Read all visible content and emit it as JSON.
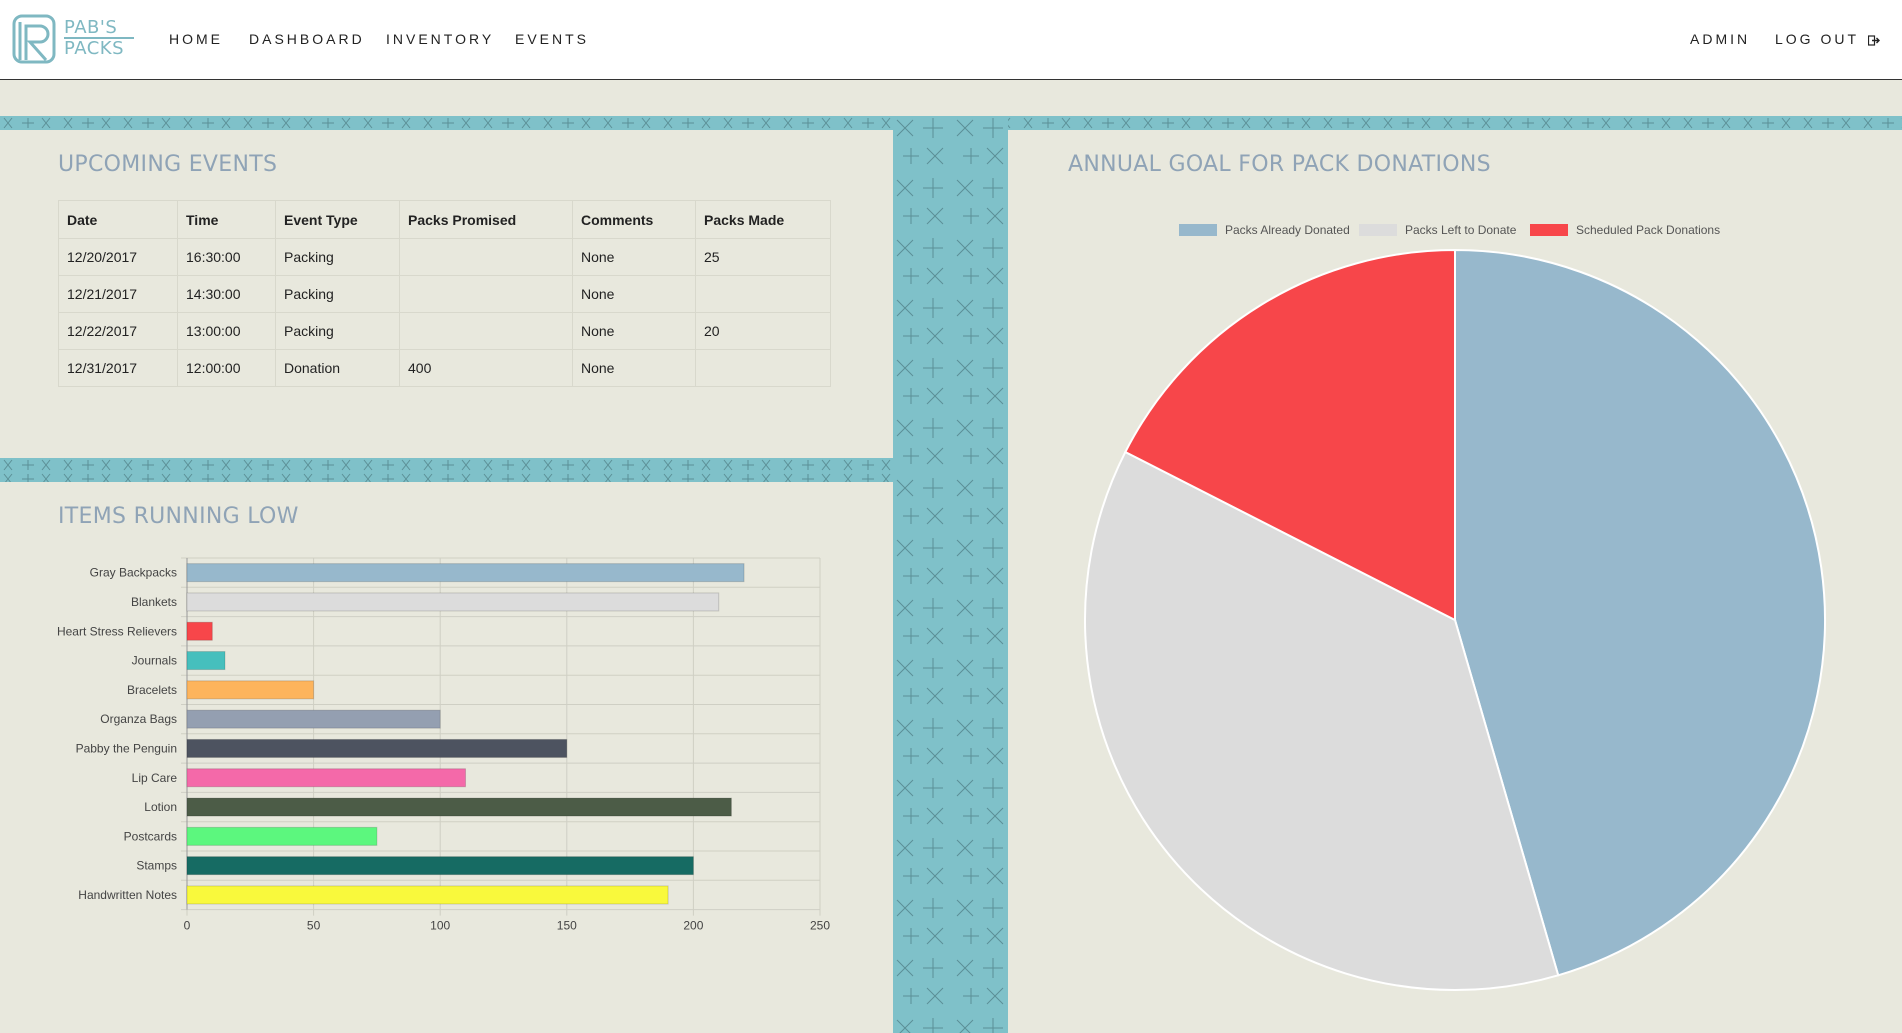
{
  "logo": {
    "line1": "PAB'S",
    "line2": "PACKS"
  },
  "nav": {
    "left": [
      "HOME",
      "DASHBOARD",
      "INVENTORY",
      "EVENTS"
    ],
    "admin": "ADMIN",
    "logout": "LOG OUT"
  },
  "events_panel": {
    "title": "UPCOMING EVENTS",
    "columns": [
      "Date",
      "Time",
      "Event Type",
      "Packs Promised",
      "Comments",
      "Packs Made"
    ],
    "rows": [
      [
        "12/20/2017",
        "16:30:00",
        "Packing",
        "",
        "None",
        "25"
      ],
      [
        "12/21/2017",
        "14:30:00",
        "Packing",
        "",
        "None",
        ""
      ],
      [
        "12/22/2017",
        "13:00:00",
        "Packing",
        "",
        "None",
        "20"
      ],
      [
        "12/31/2017",
        "12:00:00",
        "Donation",
        "400",
        "None",
        ""
      ]
    ]
  },
  "items_panel": {
    "title": "ITEMS RUNNING LOW"
  },
  "goal_panel": {
    "title": "ANNUAL GOAL FOR PACK DONATIONS"
  },
  "colors": {
    "accent_stripe": "#7fc1c9",
    "title": "#8fa3b6"
  },
  "chart_data": [
    {
      "type": "bar",
      "orientation": "horizontal",
      "categories": [
        "Gray Backpacks",
        "Blankets",
        "Heart Stress Relievers",
        "Journals",
        "Bracelets",
        "Organza Bags",
        "Pabby the Penguin",
        "Lip Care",
        "Lotion",
        "Postcards",
        "Stamps",
        "Handwritten Notes"
      ],
      "values": [
        220,
        210,
        10,
        15,
        50,
        100,
        150,
        110,
        215,
        75,
        200,
        190
      ],
      "colors": [
        "#97b8cc",
        "#dcdcdc",
        "#f7464a",
        "#46bfbd",
        "#fdb45c",
        "#949fb1",
        "#4d5360",
        "#f469a9",
        "#4c5c47",
        "#5cf77e",
        "#166b63",
        "#f9f93c"
      ],
      "xlim": [
        0,
        250
      ],
      "xticks": [
        0,
        50,
        100,
        150,
        200,
        250
      ],
      "grid": true
    },
    {
      "type": "pie",
      "labels": [
        "Packs Already Donated",
        "Packs Left to Donate",
        "Scheduled Pack Donations"
      ],
      "values": [
        45.5,
        37,
        17.5
      ],
      "colors": [
        "#97b8cc",
        "#dcdcdc",
        "#f7464a"
      ],
      "legend_position": "top"
    }
  ]
}
